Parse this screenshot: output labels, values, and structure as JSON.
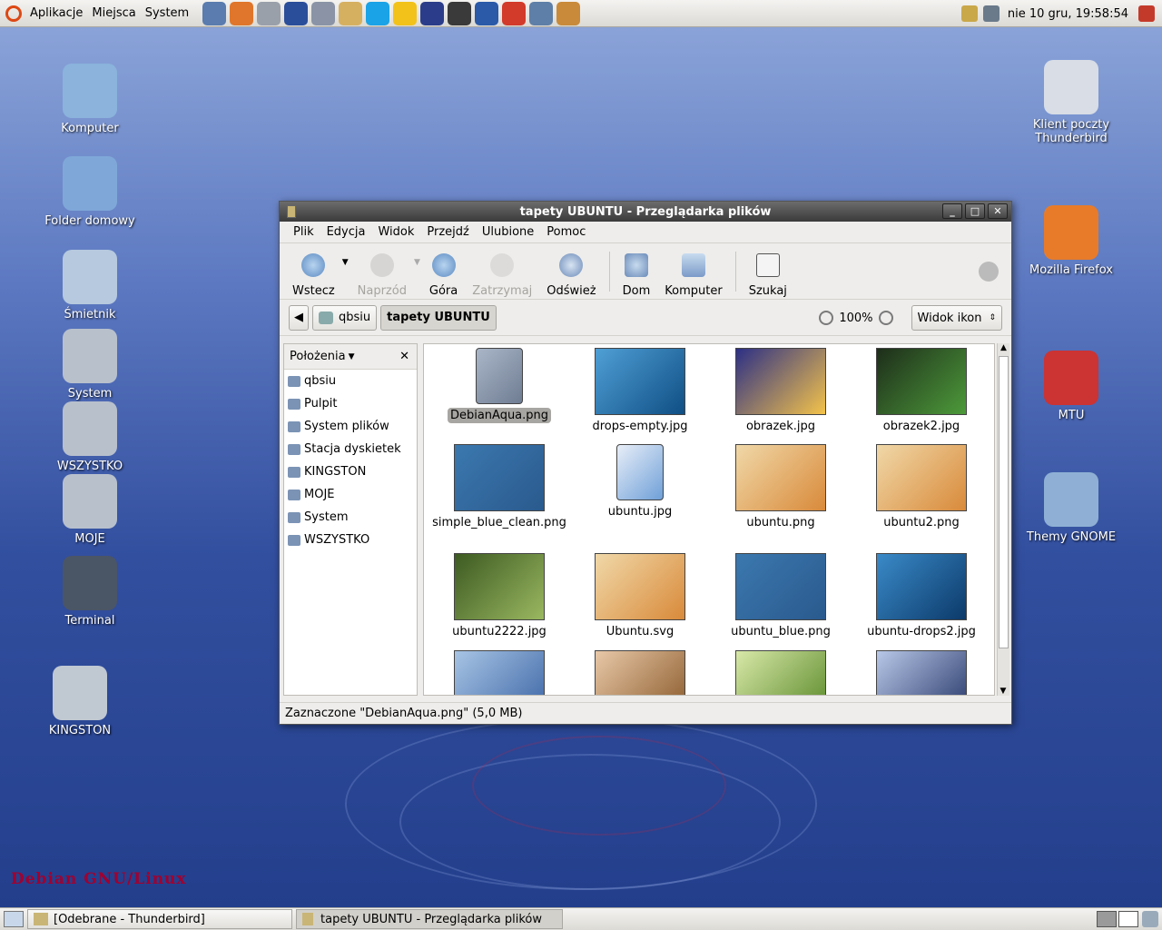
{
  "top_panel": {
    "menus": [
      "Aplikacje",
      "Miejsca",
      "System"
    ],
    "launcher_icons": [
      "monitor-icon",
      "firefox-icon",
      "network-icon",
      "notes-icon",
      "scanner-icon",
      "gimp-icon",
      "skype-icon",
      "weather-sun-icon",
      "wizard-icon",
      "terminal-icon",
      "mplayer-icon",
      "mb-icon",
      "network-manager-icon",
      "cd-icon"
    ],
    "launcher_colors": [
      "#5a7cae",
      "#e0762b",
      "#9aa0aa",
      "#2b4e9a",
      "#8a94a6",
      "#d6b061",
      "#1aa3e6",
      "#f2c21a",
      "#2b3d8a",
      "#3a3a3a",
      "#2a5aa8",
      "#d23a2a",
      "#5e7fa7",
      "#c98a3a"
    ],
    "clock": "nie 10 gru, 19:58:54"
  },
  "desktop_icons": [
    {
      "label": "Komputer",
      "icon": "computer-icon",
      "color": "#8bb3dc"
    },
    {
      "label": "Folder domowy",
      "icon": "home-folder-icon",
      "color": "#7fa8d8"
    },
    {
      "label": "Śmietnik",
      "icon": "trash-icon",
      "color": "#b6c9de"
    },
    {
      "label": "System",
      "icon": "drive-icon",
      "color": "#b8c0cc"
    },
    {
      "label": "WSZYSTKO",
      "icon": "drive-icon",
      "color": "#b8c0cc"
    },
    {
      "label": "MOJE",
      "icon": "drive-icon",
      "color": "#b8c0cc"
    },
    {
      "label": "Terminal",
      "icon": "terminal-icon",
      "color": "#4a5566"
    },
    {
      "label": "KINGSTON",
      "icon": "usb-drive-icon",
      "color": "#c0c8d2"
    },
    {
      "label": "Klient poczty Thunderbird",
      "icon": "thunderbird-icon",
      "color": "#d8dde6"
    },
    {
      "label": "Mozilla Firefox",
      "icon": "firefox-icon",
      "color": "#e87b2a"
    },
    {
      "label": "MTU",
      "icon": "floppy-cd-icon",
      "color": "#cc3333"
    },
    {
      "label": "Themy GNOME",
      "icon": "themes-folder-icon",
      "color": "#8fb0d4"
    }
  ],
  "desktop_watermark": "Debian GNU/Linux",
  "window": {
    "title": "tapety UBUNTU - Przeglądarka plików",
    "menu": [
      "Plik",
      "Edycja",
      "Widok",
      "Przejdź",
      "Ulubione",
      "Pomoc"
    ],
    "toolbar": {
      "back": "Wstecz",
      "forward": "Naprzód",
      "up": "Góra",
      "stop": "Zatrzymaj",
      "reload": "Odśwież",
      "home": "Dom",
      "computer": "Komputer",
      "search": "Szukaj"
    },
    "location": {
      "parent": "qbsiu",
      "current": "tapety UBUNTU",
      "zoom": "100%",
      "view": "Widok ikon"
    },
    "side_pane": {
      "title": "Położenia",
      "places": [
        "qbsiu",
        "Pulpit",
        "System plików",
        "Stacja dyskietek",
        "KINGSTON",
        "MOJE",
        "System",
        "WSZYSTKO"
      ]
    },
    "files": [
      {
        "name": "DebianAqua.png",
        "type": "png-file",
        "selected": true,
        "colors": [
          "#aab6c8",
          "#6f7d93"
        ]
      },
      {
        "name": "drops-empty.jpg",
        "colors": [
          "#4f9fd5",
          "#0f4f85"
        ]
      },
      {
        "name": "obrazek.jpg",
        "colors": [
          "#2c2f85",
          "#f4c34a"
        ]
      },
      {
        "name": "obrazek2.jpg",
        "colors": [
          "#1d2d1a",
          "#4d9a3a"
        ]
      },
      {
        "name": "simple_blue_clean.png",
        "colors": [
          "#3b78ae",
          "#2a5a8e"
        ]
      },
      {
        "name": "ubuntu.jpg",
        "type": "jpeg-file",
        "colors": [
          "#e8eef8",
          "#6fa0d8"
        ]
      },
      {
        "name": "ubuntu.png",
        "colors": [
          "#f0d8a8",
          "#d98a3a"
        ]
      },
      {
        "name": "ubuntu2.png",
        "colors": [
          "#f0d8a8",
          "#d98a3a"
        ]
      },
      {
        "name": "ubuntu2222.jpg",
        "colors": [
          "#3d5a22",
          "#9ab860"
        ]
      },
      {
        "name": "Ubuntu.svg",
        "colors": [
          "#f0d8a8",
          "#d98a3a"
        ]
      },
      {
        "name": "ubuntu_blue.png",
        "colors": [
          "#3b78ae",
          "#2a5a8e"
        ]
      },
      {
        "name": "ubuntu-drops2.jpg",
        "colors": [
          "#3a8ac8",
          "#0c3a6a"
        ]
      },
      {
        "name": "",
        "colors": [
          "#a7c4e4",
          "#3d66a6"
        ]
      },
      {
        "name": "",
        "colors": [
          "#e8c8a8",
          "#8a5a2a"
        ]
      },
      {
        "name": "",
        "colors": [
          "#d8e8a8",
          "#5a8a2a"
        ]
      },
      {
        "name": "",
        "colors": [
          "#b8c8e8",
          "#28386a"
        ]
      }
    ],
    "status": "Zaznaczone \"DebianAqua.png\" (5,0 MB)"
  },
  "bottom_panel": {
    "tasks": [
      "[Odebrane - Thunderbird]",
      "tapety UBUNTU - Przeglądarka plików"
    ]
  }
}
